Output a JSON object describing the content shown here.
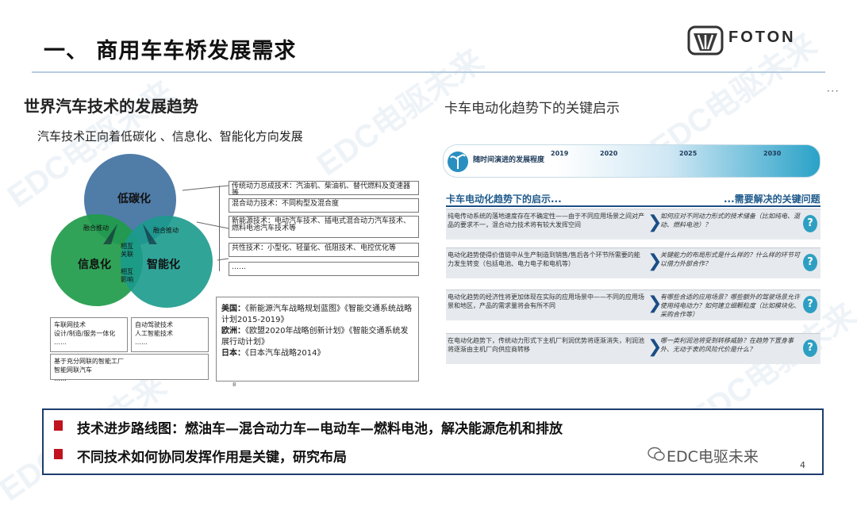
{
  "title": "一、 商用车车桥发展需求",
  "logo": {
    "text": "FOTON"
  },
  "watermark": "EDC电驱未来",
  "left": {
    "section_title": "世界汽车技术的发展趋势",
    "subtitle": "汽车技术正向着低碳化 、信息化、智能化方向发展",
    "circles": {
      "low_carbon": "低碳化",
      "informatization": "信息化",
      "intelligence": "智能化",
      "fusion_left": "融合推动",
      "fusion_right": "融合推动",
      "mutual_1": "相互关联",
      "mutual_2": "相互影响"
    },
    "tech_items": [
      "传统动力总成技术：汽油机、柴油机、替代燃料及变速器等",
      "混合动力技术：不同构型及混合度",
      "新能源技术：电动汽车技术、插电式混合动力汽车技术、燃料电池汽车技术等",
      "共性技术：小型化、轻量化、低阻技术、电控优化等",
      "……"
    ],
    "info_box": "车联网技术\n设计/制造/服务一体化\n……",
    "intel_box": "自动驾驶技术\n人工智能技术\n……",
    "factory_box": "基于充分网联的智能工厂\n智能网联汽车\n……",
    "plans": [
      {
        "country": "美国：",
        "text": "《新能源汽车战略规划蓝图》《智能交通系统战略计划2015-2019》"
      },
      {
        "country": "欧洲：",
        "text": "《欧盟2020年战略创新计划》《智能交通系统发展行动计划》"
      },
      {
        "country": "日本：",
        "text": "《日本汽车战略2014》"
      }
    ],
    "small_mark": "8"
  },
  "right": {
    "title": "卡车电动化趋势下的关键启示",
    "timeline_label": "随时间演进的发展程度",
    "years": [
      "2019",
      "2020",
      "2025",
      "2030"
    ],
    "left_heading": "卡车电动化趋势下的启示...",
    "right_heading": "...需要解决的关键问题",
    "rows": [
      {
        "left": "纯电传动系统的落地速度存在不确定性——由于不同应用场景之间对产品的要求不一，混合动力技术将有较大发挥空间",
        "right": "如何应对不同动力形式的技术储备（比如纯电、混动、燃料电池）？"
      },
      {
        "left": "电动化趋势使得价值链中从生产制造到销售/售后各个环节所需要的能力发生转变（包括电池、电力电子和电机等）",
        "right": "关键能力的布局形式是什么样的？什么样的环节可以借力外部合作？"
      },
      {
        "left": "电动化趋势的经济性将更加体现在实际的应用场景中——不同的应用场景和地区，产品的需求量将会有所不同",
        "right": "有哪些合适的应用场景？哪些额外的驾驶场景允许使用纯电动力？如何建立细颗粒度（比如模块化、采购合作等）"
      },
      {
        "left": "在电动化趋势下，传统动力形式下主机厂利润优势将逐渐消失，利润池将逐渐由主机厂向供应商转移",
        "right": "哪一类利润池将受到转移威胁？在趋势下置身事外、无动于衷的风险代价是什么？"
      }
    ],
    "side_mark": "• • •"
  },
  "bottom": {
    "line1": "技术进步路线图：燃油车—混合动力车—电动车—燃料电池，解决能源危机和排放",
    "line2": "不同技术如何协同发挥作用是关键，研究布局"
  },
  "brand": "EDC电驱未来",
  "page_number": "4",
  "colors": {
    "blue_circle": "#3d6e9e",
    "green_circle": "#1f9b4a",
    "teal_circle": "#1b9a8d",
    "bullet_red": "#c0121f",
    "border_navy": "#1d3d6e"
  }
}
